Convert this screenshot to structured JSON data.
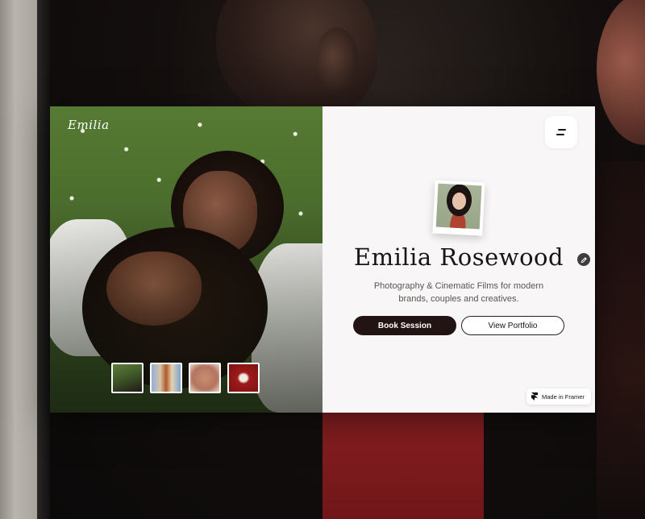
{
  "site": {
    "logo_text": "Emilia",
    "name": "Emilia Rosewood",
    "tagline": "Photography & Cinematic Films for modern brands, couples and creatives.",
    "primary_cta": "Book Session",
    "secondary_cta": "View Portfolio",
    "badge": "Made in Framer"
  },
  "thumbnails": [
    {
      "name": "grass-portrait",
      "active": true
    },
    {
      "name": "couple-portrait",
      "active": false
    },
    {
      "name": "hands-detail",
      "active": false
    },
    {
      "name": "red-backdrop-portrait",
      "active": false
    }
  ],
  "colors": {
    "content_bg": "#f8f6f6",
    "primary_button": "#231414",
    "text": "#1a1414",
    "muted_text": "#5b5555"
  },
  "icons": {
    "menu": "menu-icon",
    "edit": "pencil-icon",
    "framer": "framer-icon"
  }
}
